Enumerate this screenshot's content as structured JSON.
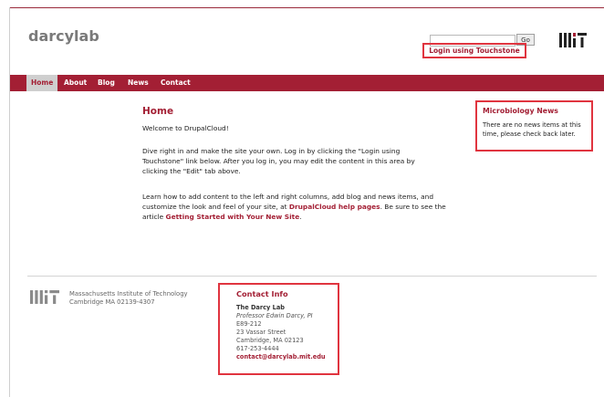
{
  "header": {
    "site_name": "darcylab",
    "search": {
      "value": "",
      "placeholder": ""
    },
    "go_label": "Go",
    "logo_text": "MIT",
    "login_label": "Login using Touchstone"
  },
  "nav": {
    "items": [
      {
        "label": "Home",
        "active": true
      },
      {
        "label": "About"
      },
      {
        "label": "Blog"
      },
      {
        "label": "News"
      },
      {
        "label": "Contact"
      }
    ]
  },
  "main": {
    "title": "Home",
    "welcome": "Welcome to DrupalCloud!",
    "para1": [
      "Dive right in and make the site your own. Log in by clicking the \"Login using",
      "Touchstone\" link below. After you log in, you may edit the content in this area by",
      "clicking the \"Edit\" tab above."
    ],
    "para2": [
      "Learn how to add content to the left and right columns, add blog and news items, and",
      "customize the look and feel of your site, at"
    ],
    "help_link": "DrupalCloud help pages",
    "para2_after_link": ". Be sure to see the",
    "para2_line3_prefix": "article",
    "article_link": "Getting Started with Your New Site",
    "para2_end": "."
  },
  "sidebar": {
    "news_title": "Microbiology News",
    "news_text": [
      "There are no news items at this",
      "time, please check back later."
    ]
  },
  "footer": {
    "logo_text": "MIT",
    "address": [
      "Massachusetts Institute of Technology",
      "Cambridge MA 02139-4307"
    ],
    "contact_title": "Contact Info",
    "contact_lines": [
      "The Darcy Lab",
      "Professor Edwin Darcy, PI",
      "E89-212",
      "23 Vassar Street",
      "Cambridge, MA 02123",
      "617-253-4444"
    ],
    "contact_email": "contact@darcylab.mit.edu"
  },
  "colors": {
    "accent": "#a31f34",
    "highlight_box": "#e0343f",
    "nav_active_bg": "#cfcfcf"
  }
}
